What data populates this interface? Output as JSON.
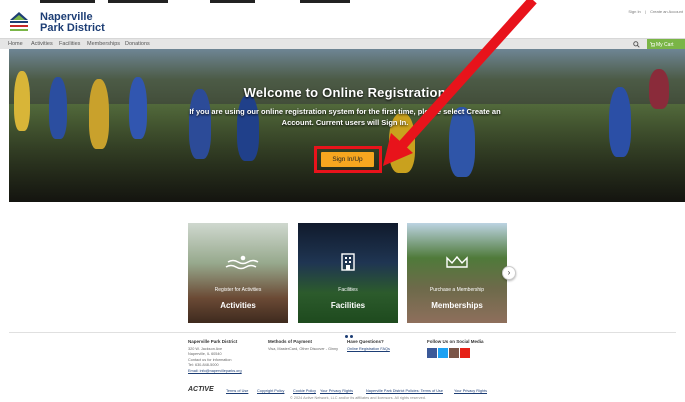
{
  "header": {
    "logo_line1": "Naperville",
    "logo_line2": "Park District",
    "signin_link": "Sign In",
    "create_account_link": "Create an Account"
  },
  "nav": {
    "items": [
      "Home",
      "Activities",
      "Facilities",
      "Memberships",
      "Donations"
    ],
    "cart_label": "My Cart"
  },
  "hero": {
    "title": "Welcome to Online Registration!",
    "subtitle": "If you are using our online registration system for the first time, please select Create an Account. Current users will Sign In.",
    "button_label": "Sign In/Up"
  },
  "cards": [
    {
      "small": "Register for Activities",
      "big": "Activities"
    },
    {
      "small": "Facilities",
      "big": "Facilities"
    },
    {
      "small": "Purchase a Membership",
      "big": "Memberships"
    }
  ],
  "footer": {
    "col1": {
      "title": "Naperville Park District",
      "lines": [
        "320 W. Jackson Ave",
        "Naperville, IL 60540",
        "Contact us for information",
        "Tel: 630-848-5000"
      ],
      "email": "Email: info@napervilleparks.org"
    },
    "col2": {
      "title": "Methods of Payment",
      "text": "Visa, MasterCard, Other Discover - Ginny"
    },
    "col3": {
      "title": "Have Questions?",
      "link": "Online Registration FAQs"
    },
    "col4": {
      "title": "Follow Us on Social Media"
    },
    "brand": "ACTIVE",
    "legal_links": [
      "Terms of Use",
      "Copyright Policy",
      "Cookie Policy",
      "Your Privacy Rights",
      "Naperville Park District Policies: Terms of Use",
      "Your Privacy Rights"
    ],
    "copyright": "© 2024 Active Network, LLC and/or its affiliates and licensors. All rights reserved."
  },
  "colors": {
    "brand_blue": "#1d3e75",
    "cart_green": "#7ab547",
    "button_orange": "#f6a61f",
    "highlight_red": "#e8131b"
  }
}
